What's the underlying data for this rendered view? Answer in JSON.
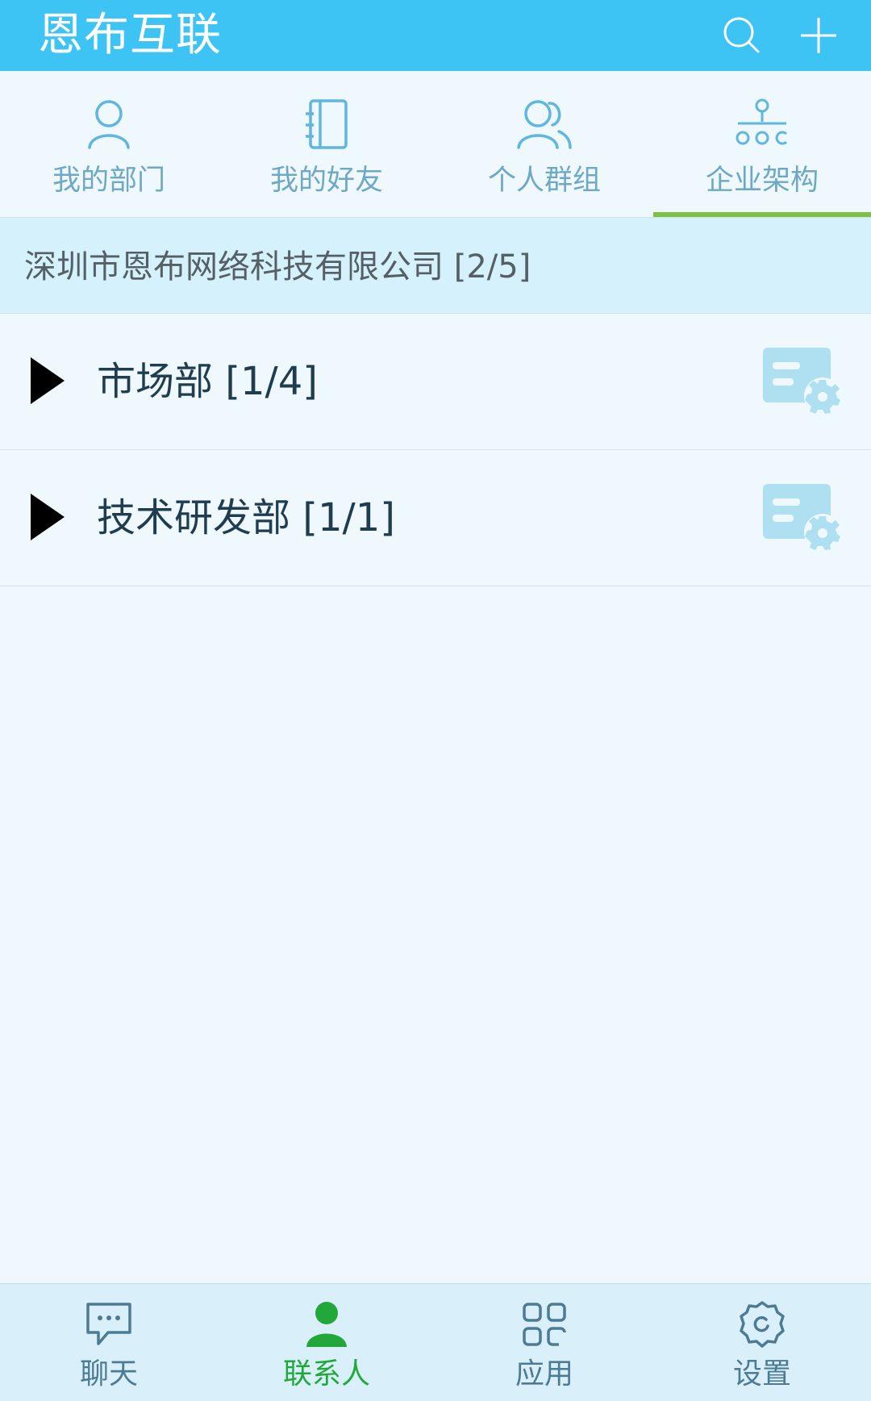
{
  "header": {
    "title": "恩布互联",
    "search_icon": "search-icon",
    "add_icon": "plus-icon"
  },
  "tabs": [
    {
      "label": "我的部门",
      "icon": "person-icon"
    },
    {
      "label": "我的好友",
      "icon": "contact-book-icon"
    },
    {
      "label": "个人群组",
      "icon": "group-icon"
    },
    {
      "label": "企业架构",
      "icon": "org-chart-icon",
      "selected": true
    }
  ],
  "company": {
    "name": "深圳市恩布网络科技有限公司 [2/5]"
  },
  "departments": [
    {
      "name": "市场部 [1/4]",
      "icon": "manage-settings-icon"
    },
    {
      "name": "技术研发部 [1/1]",
      "icon": "manage-settings-icon"
    }
  ],
  "bottom_nav": [
    {
      "label": "聊天",
      "icon": "chat-icon"
    },
    {
      "label": "联系人",
      "icon": "contact-icon",
      "active": true
    },
    {
      "label": "应用",
      "icon": "apps-icon"
    },
    {
      "label": "设置",
      "icon": "settings-icon"
    }
  ],
  "colors": {
    "header": "#3ec4f4",
    "accent_indicator": "#7bc143",
    "active_nav": "#22a83a",
    "tab_text": "#6ea8c4",
    "background": "#eef8fd"
  }
}
